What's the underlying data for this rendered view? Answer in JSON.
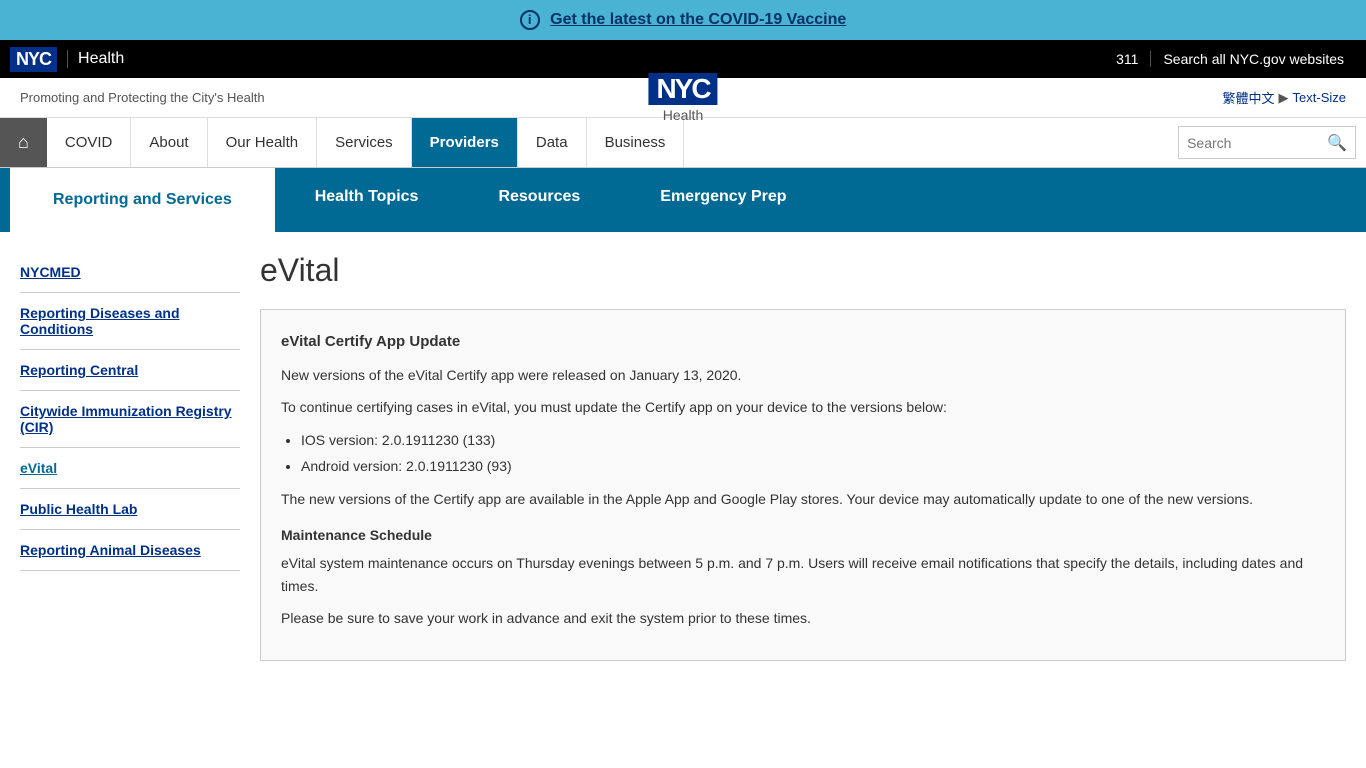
{
  "covid_banner": {
    "icon": "ⓘ",
    "link_text": "Get the latest on the COVID-19 Vaccine"
  },
  "top_bar": {
    "nyc_logo": "NYC",
    "dept_name": "Health",
    "phone": "311",
    "search_label": "Search all NYC.gov websites"
  },
  "header": {
    "tagline": "Promoting and Protecting the City's Health",
    "logo_nyc": "NYC",
    "logo_health": "Health",
    "lang_link": "繁體中文",
    "separator": "▶",
    "text_size": "Text-Size"
  },
  "main_nav": {
    "home_icon": "⌂",
    "items": [
      {
        "label": "COVID",
        "active": false
      },
      {
        "label": "About",
        "active": false
      },
      {
        "label": "Our Health",
        "active": false
      },
      {
        "label": "Services",
        "active": false
      },
      {
        "label": "Providers",
        "active": true
      },
      {
        "label": "Data",
        "active": false
      },
      {
        "label": "Business",
        "active": false
      }
    ],
    "search_placeholder": "Search"
  },
  "sub_nav": {
    "items": [
      {
        "label": "Reporting and Services",
        "active": true
      },
      {
        "label": "Health Topics",
        "active": false
      },
      {
        "label": "Resources",
        "active": false
      },
      {
        "label": "Emergency Prep",
        "active": false
      }
    ]
  },
  "sidebar": {
    "links": [
      {
        "label": "NYCMED",
        "current": false
      },
      {
        "label": "Reporting Diseases and Conditions",
        "current": false
      },
      {
        "label": "Reporting Central",
        "current": false
      },
      {
        "label": "Citywide Immunization Registry (CIR)",
        "current": false
      },
      {
        "label": "eVital",
        "current": true
      },
      {
        "label": "Public Health Lab",
        "current": false
      },
      {
        "label": "Reporting Animal Diseases",
        "current": false
      }
    ]
  },
  "main_content": {
    "page_title": "eVital",
    "update_box": {
      "heading": "eVital Certify App Update",
      "para1": "New versions of the eVital Certify app were released on January 13, 2020.",
      "para2": "To continue certifying cases in eVital, you must update the Certify app on your device to the versions below:",
      "versions": [
        "IOS version: 2.0.1911230 (133)",
        "Android version: 2.0.1911230 (93)"
      ],
      "para3": "The new versions of the Certify app are available in the Apple App and Google Play stores. Your device may automatically update to one of the new versions.",
      "maintenance_heading": "Maintenance Schedule",
      "maintenance_para": "eVital system maintenance occurs on Thursday evenings between 5 p.m. and 7 p.m. Users will receive email notifications that specify the details, including dates and times.",
      "maintenance_para2": "Please be sure to save your work in advance and exit the system prior to these times."
    }
  }
}
